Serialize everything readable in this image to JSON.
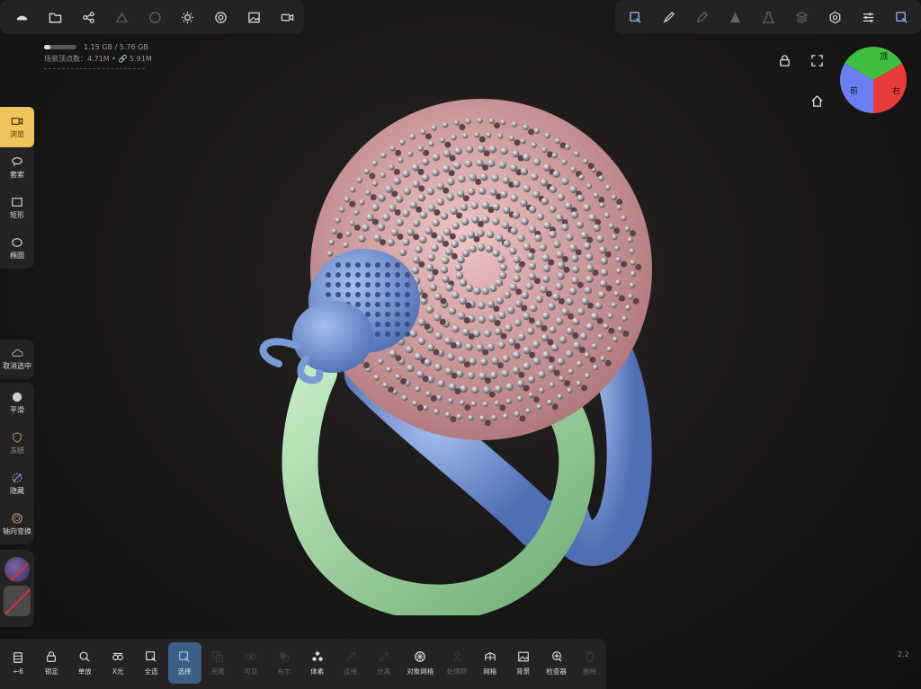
{
  "top_left_toolbar": {
    "icons": [
      "open-menu-icon",
      "folder-icon",
      "share-icon",
      "mesh-layers-icon",
      "sphere-icon",
      "light-icon",
      "material-icon",
      "image-icon",
      "camera-icon"
    ]
  },
  "top_right_toolbar": {
    "icons": [
      "select-tool-icon",
      "brush-icon",
      "pen-icon",
      "triangle-icon",
      "flask-icon",
      "layers-icon",
      "settings-icon",
      "sliders-icon",
      "select-box-icon"
    ]
  },
  "stats": {
    "memory": "1.15 GB / 5.76 GB",
    "memory_fraction": 0.2,
    "vertices_label": "场景顶点数：",
    "vertices_value": "4.71M",
    "link_value": "5.91M"
  },
  "selection_panel": {
    "items": [
      {
        "label": "浏览",
        "icon": "camera-icon",
        "active": true
      },
      {
        "label": "套索",
        "icon": "lasso-icon",
        "active": false
      },
      {
        "label": "矩形",
        "icon": "rectangle-icon",
        "active": false
      },
      {
        "label": "椭圆",
        "icon": "ellipse-icon",
        "active": false
      }
    ]
  },
  "deselect": {
    "label": "取消选中",
    "icon": "cloud-icon"
  },
  "tools_panel": {
    "items": [
      {
        "label": "平滑",
        "icon": "smooth-icon"
      },
      {
        "label": "冻结",
        "icon": "shield-icon"
      },
      {
        "label": "隐藏",
        "icon": "hide-icon"
      },
      {
        "label": "轴向变换",
        "icon": "gizmo-icon"
      }
    ]
  },
  "right_icons": {
    "lock": "lock-icon",
    "fullscreen": "fullscreen-icon",
    "home": "home-icon"
  },
  "gizmo": {
    "top_label": "顶",
    "front_label": "前",
    "right_label": "右",
    "colors": {
      "top": "#3fbf3f",
      "front": "#6b7ff2",
      "right": "#e83c3c"
    }
  },
  "bottom_bar": {
    "items": [
      {
        "label": "←6",
        "icon": "history-icon",
        "dim": false
      },
      {
        "label": "锁定",
        "icon": "lock-icon",
        "dim": false
      },
      {
        "label": "单放",
        "icon": "search-icon",
        "dim": false
      },
      {
        "label": "X光",
        "icon": "xray-icon",
        "dim": false
      },
      {
        "label": "全选",
        "icon": "select-all-icon",
        "dim": false
      },
      {
        "label": "选择",
        "icon": "select-icon",
        "dim": false,
        "selected": true
      },
      {
        "label": "克隆",
        "icon": "clone-icon",
        "dim": true
      },
      {
        "label": "可见",
        "icon": "eye-icon",
        "dim": true
      },
      {
        "label": "布尔",
        "icon": "boolean-icon",
        "dim": true
      },
      {
        "label": "体素",
        "icon": "voxel-icon",
        "dim": false
      },
      {
        "label": "连接",
        "icon": "connect-icon",
        "dim": true
      },
      {
        "label": "分离",
        "icon": "split-icon",
        "dim": true
      },
      {
        "label": "对象网格",
        "icon": "object-mesh-icon",
        "dim": false,
        "wide": true
      },
      {
        "label": "处理网",
        "icon": "person-icon",
        "dim": true
      },
      {
        "label": "网格",
        "icon": "grid-icon",
        "dim": false
      },
      {
        "label": "背景",
        "icon": "image-icon",
        "dim": false
      },
      {
        "label": "检查器",
        "icon": "inspector-icon",
        "dim": false
      },
      {
        "label": "删除",
        "icon": "trash-icon",
        "dim": true
      }
    ]
  },
  "version": "2.2",
  "colors": {
    "accent": "#f0c45c",
    "selected": "#3d5f86",
    "model_pink": "#d9a3a3",
    "model_blue": "#7b9ad9",
    "model_green": "#9fd3a0"
  }
}
